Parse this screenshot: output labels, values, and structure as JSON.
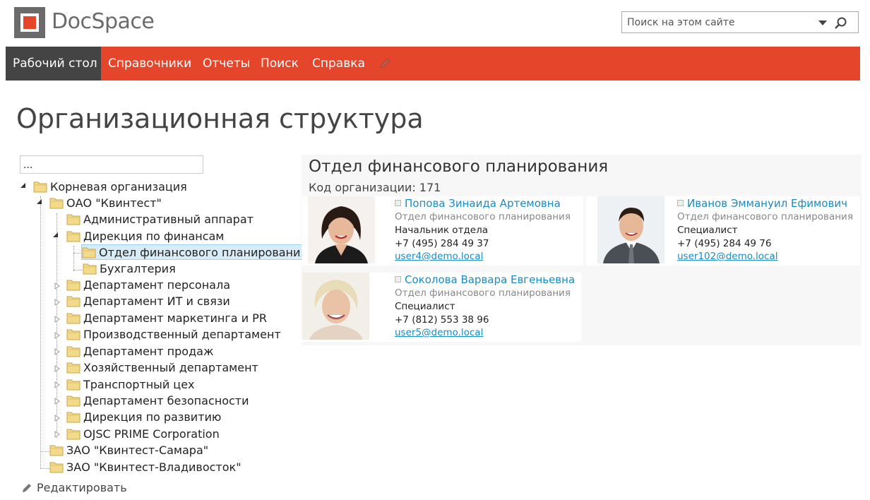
{
  "app": {
    "brand": "DocSpace"
  },
  "search": {
    "placeholder": "Поиск на этом сайте"
  },
  "nav": {
    "items": [
      "Рабочий стол",
      "Справочники",
      "Отчеты",
      "Поиск",
      "Справка"
    ],
    "active": "Рабочий стол"
  },
  "page": {
    "title": "Организационная структура"
  },
  "tree": {
    "filter_value": "...",
    "nodes": [
      "Корневая организация",
      "ОАО \"Квинтест\"",
      "Административный аппарат",
      "Дирекция по финансам",
      "Отдел финансового планирования",
      "Бухгалтерия",
      "Департамент персонала",
      "Департамент ИТ и связи",
      "Департамент маркетинга и PR",
      "Производственный департамент",
      "Департамент продаж",
      "Хозяйственный департамент",
      "Транспортный цех",
      "Департамент безопасности",
      "Дирекция по развитию",
      "OJSC PRIME Corporation",
      "ЗАО \"Квинтест-Самара\"",
      "ЗАО \"Квинтест-Владивосток\""
    ],
    "selected": "Отдел финансового планирования",
    "edit_label": "Редактировать"
  },
  "detail": {
    "title": "Отдел финансового планирования",
    "org_code": "Код организации: 171",
    "people": [
      {
        "name": "Попова Зинаида Артемовна",
        "department": "Отдел финансового планирования",
        "role": "Начальник отдела",
        "phone": "+7 (495) 284 49 37",
        "email": "user4@demo.local"
      },
      {
        "name": "Иванов Эммануил Ефимович",
        "department": "Отдел финансового планирования",
        "role": "Специалист",
        "phone": "+7 (495) 284 49 76",
        "email": "user102@demo.local"
      },
      {
        "name": "Соколова Варвара Евгеньевна",
        "department": "Отдел финансового планирования",
        "role": "Специалист",
        "phone": "+7 (812) 553 38 96",
        "email": "user5@demo.local"
      }
    ]
  },
  "colors": {
    "accent": "#e5462b",
    "nav_active": "#444444",
    "link": "#1a8bc3",
    "selection": "#d8ecf8"
  }
}
